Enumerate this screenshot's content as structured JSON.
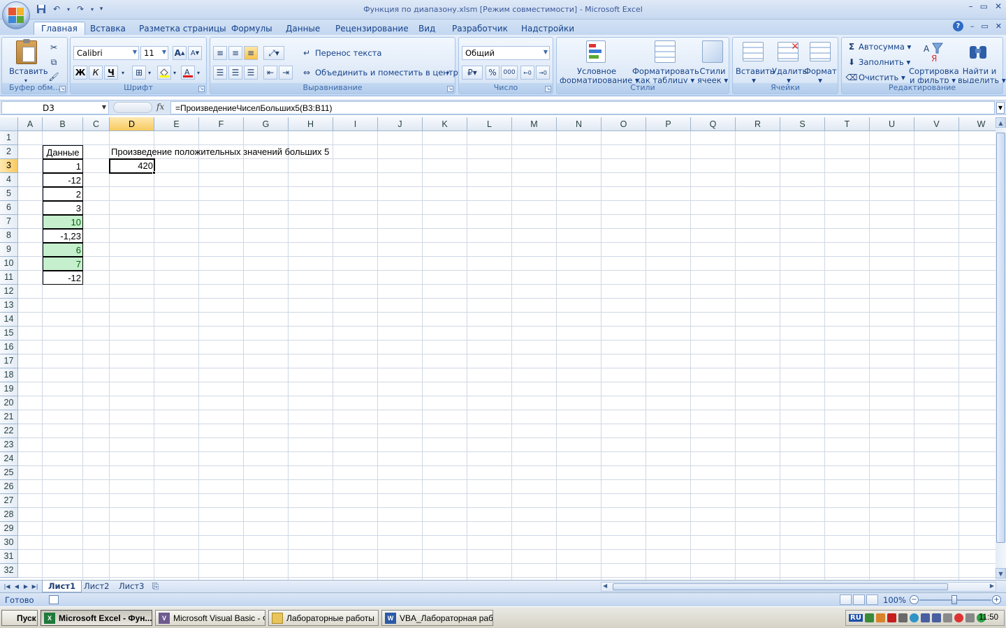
{
  "window": {
    "title": "Функция по диапазону.xlsm  [Режим совместимости] - Microsoft Excel"
  },
  "ribbon": {
    "tabs": [
      "Главная",
      "Вставка",
      "Разметка страницы",
      "Формулы",
      "Данные",
      "Рецензирование",
      "Вид",
      "Разработчик",
      "Надстройки"
    ],
    "active_tab": "Главная",
    "clipboard": {
      "label": "Буфер обм...",
      "paste": "Вставить"
    },
    "font": {
      "label": "Шрифт",
      "name": "Calibri",
      "size": "11",
      "bold": "Ж",
      "italic": "К",
      "underline": "Ч",
      "grow": "A",
      "shrink": "A"
    },
    "alignment": {
      "label": "Выравнивание",
      "wrap": "Перенос текста",
      "merge": "Объединить и поместить в центре"
    },
    "number": {
      "label": "Число",
      "format": "Общий",
      "percent": "%",
      "thousands": "000"
    },
    "styles": {
      "label": "Стили",
      "conditional_1": "Условное",
      "conditional_2": "форматирование",
      "table_1": "Форматировать",
      "table_2": "как таблицу",
      "cell_1": "Стили",
      "cell_2": "ячеек"
    },
    "cells": {
      "label": "Ячейки",
      "insert": "Вставить",
      "delete": "Удалить",
      "format": "Формат"
    },
    "editing": {
      "label": "Редактирование",
      "autosum": "Автосумма",
      "fill": "Заполнить",
      "clear": "Очистить",
      "sort_1": "Сортировка",
      "sort_2": "и фильтр",
      "find_1": "Найти и",
      "find_2": "выделить"
    }
  },
  "formula_bar": {
    "name_box": "D3",
    "fx": "fx",
    "formula": "=ПроизведениеЧиселБольших5(B3:B11)"
  },
  "sheet": {
    "columns": [
      "A",
      "B",
      "C",
      "D",
      "E",
      "F",
      "G",
      "H",
      "I",
      "J",
      "K",
      "L",
      "M",
      "N",
      "O",
      "P",
      "Q",
      "R",
      "S",
      "T",
      "U",
      "V",
      "W"
    ],
    "selected_column": "D",
    "selected_row": 3,
    "rows": [
      "1",
      "2",
      "3",
      "4",
      "5",
      "6",
      "7",
      "8",
      "9",
      "10",
      "11",
      "12",
      "13",
      "14",
      "15",
      "16",
      "17",
      "18",
      "19",
      "20",
      "21",
      "22",
      "23",
      "24",
      "25",
      "26",
      "27",
      "28",
      "29",
      "30",
      "31",
      "32"
    ],
    "header_b2": "Данные",
    "d2_text": "Произведение положительных значений больших 5",
    "d3_value": "420",
    "data_values": [
      "1",
      "-12",
      "2",
      "3",
      "10",
      "-1,23",
      "6",
      "7",
      "-12"
    ],
    "highlight_color": "#c6efce",
    "highlight_text_color": "#006100"
  },
  "sheet_tabs": [
    "Лист1",
    "Лист2",
    "Лист3"
  ],
  "status": {
    "text": "Готово",
    "zoom": "100%"
  },
  "taskbar": {
    "start": "Пуск",
    "tasks": [
      "Microsoft Excel - Фун...",
      "Microsoft Visual Basic - Ф...",
      "Лабораторные работы",
      "VBA_Лабораторная раб..."
    ],
    "lang": "RU",
    "clock": "11:50"
  }
}
